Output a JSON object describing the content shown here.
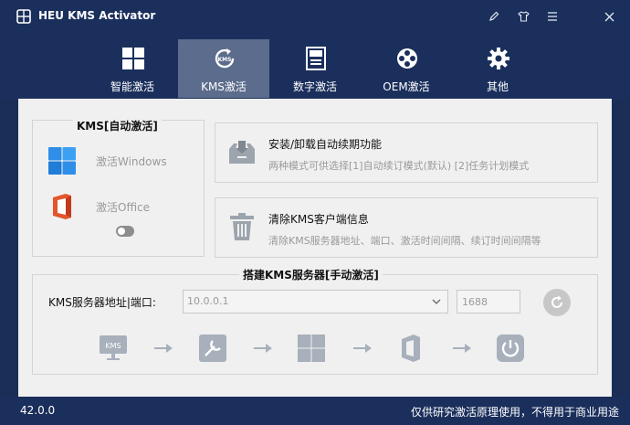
{
  "window": {
    "title": "HEU KMS Activator",
    "controls": [
      "edit-icon",
      "shirt-icon",
      "menu-icon",
      "close-icon"
    ]
  },
  "tabs": [
    {
      "label": "智能激活",
      "icon": "windows-grid-icon",
      "active": false
    },
    {
      "label": "KMS激活",
      "icon": "kms-refresh-icon",
      "active": true
    },
    {
      "label": "数字激活",
      "icon": "digital-license-icon",
      "active": false
    },
    {
      "label": "OEM激活",
      "icon": "oem-reel-icon",
      "active": false
    },
    {
      "label": "其他",
      "icon": "gear-icon",
      "active": false
    }
  ],
  "kms_auto": {
    "title": "KMS[自动激活]",
    "activate_windows": "激活Windows",
    "activate_office": "激活Office"
  },
  "cards": {
    "renew": {
      "title": "安装/卸载自动续期功能",
      "desc": "两种模式可供选择[1]自动续订模式(默认) [2]任务计划模式"
    },
    "clear": {
      "title": "清除KMS客户端信息",
      "desc": "清除KMS服务器地址、端口、激活时间间隔、续订时间间隔等"
    }
  },
  "server": {
    "title": "搭建KMS服务器[手动激活]",
    "label": "KMS服务器地址|端口:",
    "address": "10.0.0.1",
    "port": "1688"
  },
  "steps": [
    "kms-monitor-icon",
    "install-tool-icon",
    "windows-icon",
    "office-icon",
    "power-icon"
  ],
  "status": {
    "version": "42.0.0",
    "note": "仅供研究激活原理使用，不得用于商业用途"
  },
  "colors": {
    "header": "#1b2f5c",
    "active_tab": "#5c6c8c",
    "content": "#f0f0f0",
    "disabled_text": "#9a9a9a"
  }
}
